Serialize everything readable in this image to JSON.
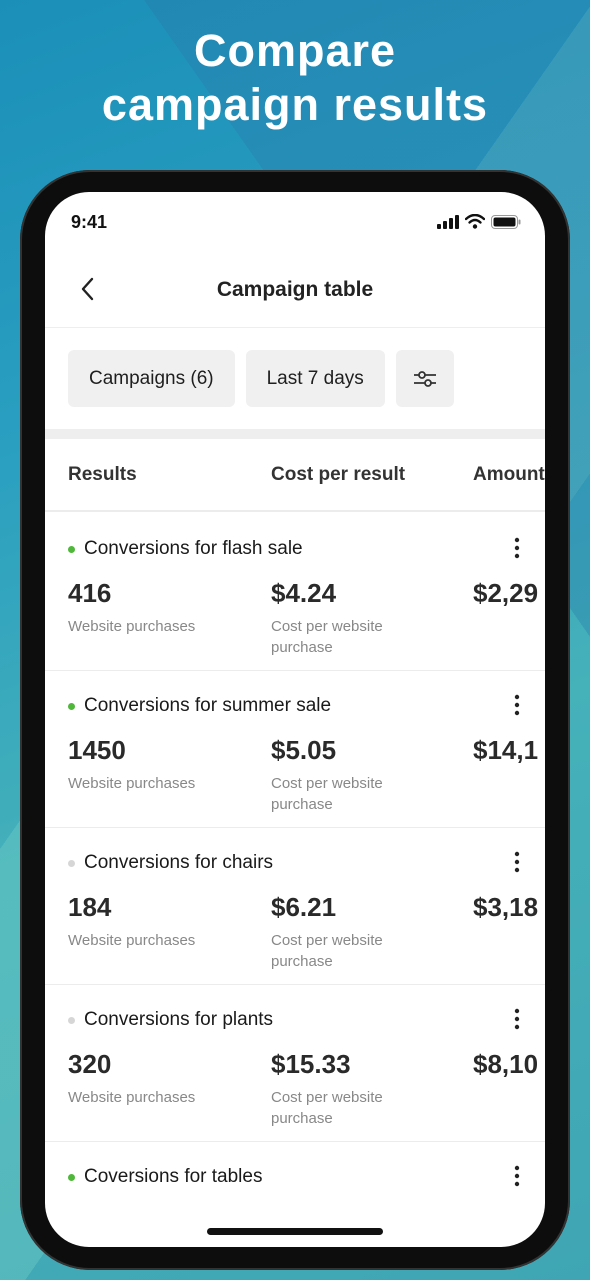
{
  "headline": {
    "line1": "Compare",
    "line2": "campaign results"
  },
  "status_bar": {
    "time": "9:41"
  },
  "nav": {
    "title": "Campaign table"
  },
  "filters": {
    "campaigns": "Campaigns (6)",
    "date_range": "Last 7 days"
  },
  "columns": {
    "results": "Results",
    "cost_per_result": "Cost per result",
    "amount": "Amount spent"
  },
  "colors": {
    "active": "#4fb83a",
    "inactive": "#d6d6d6"
  },
  "rows": [
    {
      "title": "Conversions for flash sale",
      "status": "active",
      "results": "416",
      "results_label": "Website purchases",
      "cost": "$4.24",
      "cost_label_1": "Cost per website",
      "cost_label_2": "purchase",
      "amount": "$2,29"
    },
    {
      "title": "Conversions for summer sale",
      "status": "active",
      "results": "1450",
      "results_label": "Website purchases",
      "cost": "$5.05",
      "cost_label_1": "Cost per website",
      "cost_label_2": "purchase",
      "amount": "$14,1"
    },
    {
      "title": "Conversions for chairs",
      "status": "inactive",
      "results": "184",
      "results_label": "Website purchases",
      "cost": "$6.21",
      "cost_label_1": "Cost per website",
      "cost_label_2": "purchase",
      "amount": "$3,18"
    },
    {
      "title": "Conversions for plants",
      "status": "inactive",
      "results": "320",
      "results_label": "Website purchases",
      "cost": "$15.33",
      "cost_label_1": "Cost per website",
      "cost_label_2": "purchase",
      "amount": "$8,10"
    },
    {
      "title": "Coversions for tables",
      "status": "active"
    }
  ]
}
